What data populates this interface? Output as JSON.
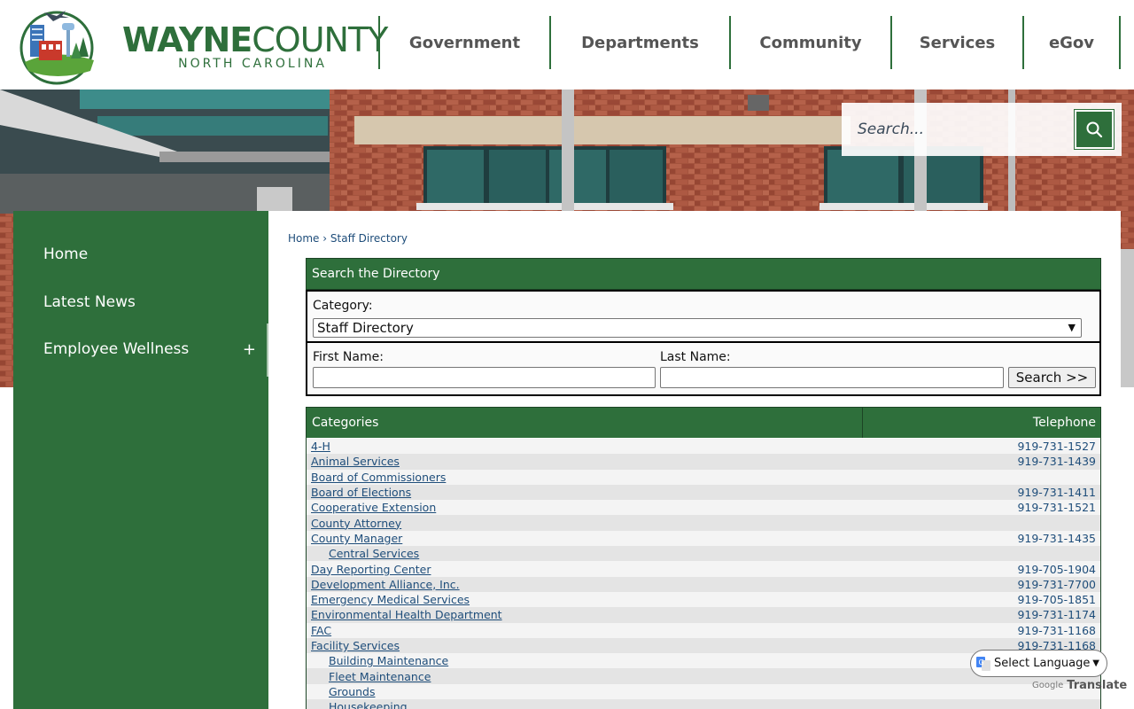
{
  "logo": {
    "word1": "WAYNE",
    "word2": "COUNTY",
    "subtitle": "NORTH CAROLINA"
  },
  "nav": {
    "items": [
      {
        "label": "Government"
      },
      {
        "label": "Departments"
      },
      {
        "label": "Community"
      },
      {
        "label": "Services"
      },
      {
        "label": "eGov"
      }
    ]
  },
  "search": {
    "placeholder": "Search..."
  },
  "sidebar": {
    "items": [
      {
        "label": "Home"
      },
      {
        "label": "Latest News"
      },
      {
        "label": "Employee Wellness",
        "expand": "+"
      }
    ]
  },
  "breadcrumb": {
    "home": "Home",
    "separator": "›",
    "current": "Staff Directory"
  },
  "directory_search": {
    "title": "Search the Directory",
    "category_label": "Category:",
    "category_selected": "Staff Directory",
    "first_name_label": "First Name:",
    "last_name_label": "Last Name:",
    "search_button": "Search >>"
  },
  "table": {
    "col_categories": "Categories",
    "col_telephone": "Telephone",
    "rows": [
      {
        "name": "4-H",
        "tel": "919-731-1527",
        "sub": false
      },
      {
        "name": "Animal Services",
        "tel": "919-731-1439",
        "sub": false
      },
      {
        "name": "Board of Commissioners",
        "tel": "",
        "sub": false
      },
      {
        "name": "Board of Elections",
        "tel": "919-731-1411",
        "sub": false
      },
      {
        "name": "Cooperative Extension",
        "tel": "919-731-1521",
        "sub": false
      },
      {
        "name": "County Attorney",
        "tel": "",
        "sub": false
      },
      {
        "name": "County Manager",
        "tel": "919-731-1435",
        "sub": false
      },
      {
        "name": "Central Services",
        "tel": "",
        "sub": true
      },
      {
        "name": "Day Reporting Center",
        "tel": "919-705-1904",
        "sub": false
      },
      {
        "name": "Development Alliance, Inc.",
        "tel": "919-731-7700",
        "sub": false
      },
      {
        "name": "Emergency Medical Services",
        "tel": "919-705-1851",
        "sub": false
      },
      {
        "name": "Environmental Health Department",
        "tel": "919-731-1174",
        "sub": false
      },
      {
        "name": "FAC",
        "tel": "919-731-1168",
        "sub": false
      },
      {
        "name": "Facility Services",
        "tel": "919-731-1168",
        "sub": false
      },
      {
        "name": "Building Maintenance",
        "tel": "",
        "sub": true
      },
      {
        "name": "Fleet Maintenance",
        "tel": "",
        "sub": true
      },
      {
        "name": "Grounds",
        "tel": "",
        "sub": true
      },
      {
        "name": "Housekeeping",
        "tel": "",
        "sub": true
      }
    ]
  },
  "translate": {
    "label": "Select Language",
    "powered_by": "Google",
    "translate_word": "Translate"
  },
  "colors": {
    "brand_green": "#2e6f3b",
    "link_blue": "#1e4d7a"
  }
}
